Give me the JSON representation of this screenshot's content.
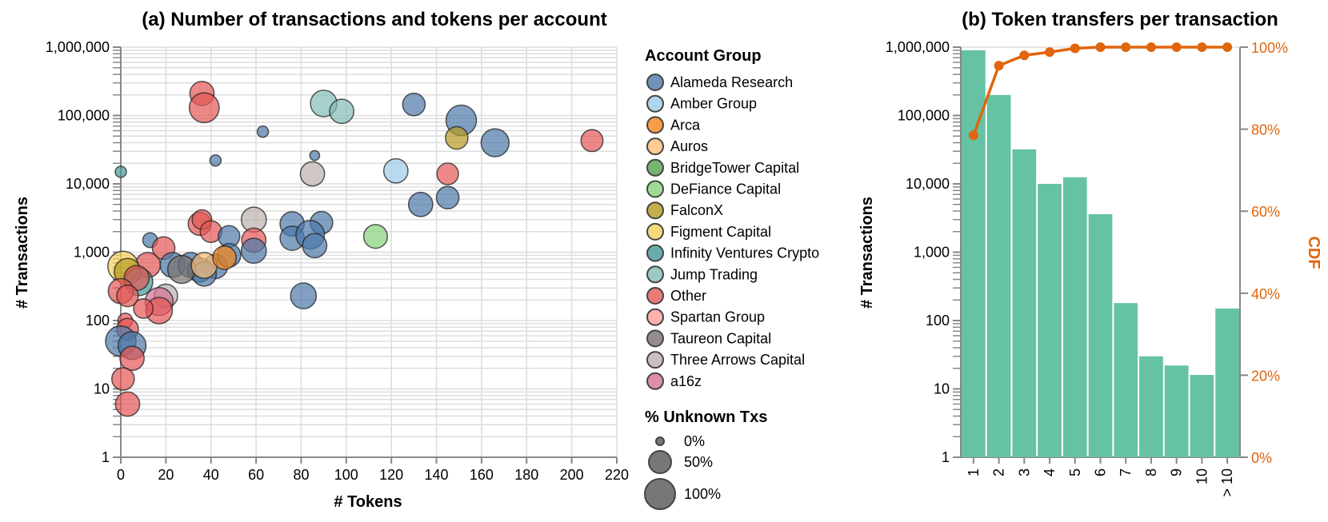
{
  "chart_data": [
    {
      "type": "scatter",
      "title": "(a) Number of transactions and tokens per account",
      "xlabel": "# Tokens",
      "ylabel": "# Transactions",
      "xlim": [
        0,
        220
      ],
      "ylim": [
        1,
        1000000
      ],
      "yscale": "log",
      "grid": true,
      "xticks": [
        0,
        20,
        40,
        60,
        80,
        100,
        120,
        140,
        160,
        180,
        200,
        220
      ],
      "yticks": [
        1,
        10,
        100,
        1000,
        10000,
        100000,
        1000000
      ],
      "ytick_labels": [
        "1",
        "10",
        "100",
        "1,000",
        "10,000",
        "100,000",
        "1,000,000"
      ],
      "legend": {
        "placement": "right",
        "color_title": "Account Group",
        "groups": [
          {
            "name": "Alameda Research",
            "color": "#4c78a8"
          },
          {
            "name": "Amber Group",
            "color": "#9ecae9"
          },
          {
            "name": "Arca",
            "color": "#f58518"
          },
          {
            "name": "Auros",
            "color": "#ffbf79"
          },
          {
            "name": "BridgeTower Capital",
            "color": "#54a24b"
          },
          {
            "name": "DeFiance Capital",
            "color": "#88d27a"
          },
          {
            "name": "FalconX",
            "color": "#b79a20"
          },
          {
            "name": "Figment Capital",
            "color": "#f2cf5b"
          },
          {
            "name": "Infinity Ventures Crypto",
            "color": "#439894"
          },
          {
            "name": "Jump Trading",
            "color": "#83bcb6"
          },
          {
            "name": "Other",
            "color": "#e45756"
          },
          {
            "name": "Spartan Group",
            "color": "#ff9d98"
          },
          {
            "name": "Taureon Capital",
            "color": "#79706e"
          },
          {
            "name": "Three Arrows Capital",
            "color": "#bab0ac"
          },
          {
            "name": "a16z",
            "color": "#d67195"
          }
        ],
        "size_title": "% Unknown Txs",
        "size_entries": [
          {
            "label": "0%",
            "value": 0
          },
          {
            "label": "50%",
            "value": 50
          },
          {
            "label": "100%",
            "value": 100
          }
        ]
      },
      "points": [
        {
          "group": "Other",
          "x": 36,
          "y": 210000,
          "unknown": 55
        },
        {
          "group": "Other",
          "x": 37,
          "y": 130000,
          "unknown": 95
        },
        {
          "group": "Alameda Research",
          "x": 63,
          "y": 58000,
          "unknown": 4
        },
        {
          "group": "Alameda Research",
          "x": 42,
          "y": 22000,
          "unknown": 4
        },
        {
          "group": "Alameda Research",
          "x": 86,
          "y": 26000,
          "unknown": 2
        },
        {
          "group": "Infinity Ventures Crypto",
          "x": 0,
          "y": 15000,
          "unknown": 4
        },
        {
          "group": "Jump Trading",
          "x": 90,
          "y": 150000,
          "unknown": 70
        },
        {
          "group": "Jump Trading",
          "x": 98,
          "y": 115000,
          "unknown": 55
        },
        {
          "group": "Alameda Research",
          "x": 130,
          "y": 145000,
          "unknown": 45
        },
        {
          "group": "Alameda Research",
          "x": 151,
          "y": 85000,
          "unknown": 100
        },
        {
          "group": "FalconX",
          "x": 149,
          "y": 47000,
          "unknown": 45
        },
        {
          "group": "Alameda Research",
          "x": 166,
          "y": 40000,
          "unknown": 80
        },
        {
          "group": "Other",
          "x": 209,
          "y": 43000,
          "unknown": 42
        },
        {
          "group": "Three Arrows Capital",
          "x": 85,
          "y": 14000,
          "unknown": 55
        },
        {
          "group": "Amber Group",
          "x": 122,
          "y": 15500,
          "unknown": 55
        },
        {
          "group": "Other",
          "x": 145,
          "y": 14000,
          "unknown": 40
        },
        {
          "group": "Alameda Research",
          "x": 145,
          "y": 6300,
          "unknown": 45
        },
        {
          "group": "Alameda Research",
          "x": 133,
          "y": 5000,
          "unknown": 55
        },
        {
          "group": "DeFiance Capital",
          "x": 113,
          "y": 1700,
          "unknown": 52
        },
        {
          "group": "Three Arrows Capital",
          "x": 59,
          "y": 3000,
          "unknown": 60
        },
        {
          "group": "Other",
          "x": 35,
          "y": 2600,
          "unknown": 48
        },
        {
          "group": "Other",
          "x": 36,
          "y": 3000,
          "unknown": 30
        },
        {
          "group": "Other",
          "x": 40,
          "y": 2000,
          "unknown": 40
        },
        {
          "group": "Other",
          "x": 59,
          "y": 1500,
          "unknown": 55
        },
        {
          "group": "Alameda Research",
          "x": 59,
          "y": 1050,
          "unknown": 60
        },
        {
          "group": "Alameda Research",
          "x": 48,
          "y": 1700,
          "unknown": 40
        },
        {
          "group": "Alameda Research",
          "x": 76,
          "y": 2600,
          "unknown": 55
        },
        {
          "group": "Alameda Research",
          "x": 89,
          "y": 2700,
          "unknown": 45
        },
        {
          "group": "Alameda Research",
          "x": 76,
          "y": 1600,
          "unknown": 55
        },
        {
          "group": "Alameda Research",
          "x": 84,
          "y": 1800,
          "unknown": 85
        },
        {
          "group": "Alameda Research",
          "x": 86,
          "y": 1250,
          "unknown": 55
        },
        {
          "group": "Alameda Research",
          "x": 81,
          "y": 230,
          "unknown": 65
        },
        {
          "group": "Alameda Research",
          "x": 13,
          "y": 1500,
          "unknown": 12
        },
        {
          "group": "Other",
          "x": 19,
          "y": 1150,
          "unknown": 45
        },
        {
          "group": "Other",
          "x": 12,
          "y": 650,
          "unknown": 60
        },
        {
          "group": "Alameda Research",
          "x": 23,
          "y": 650,
          "unknown": 60
        },
        {
          "group": "Alameda Research",
          "x": 31,
          "y": 650,
          "unknown": 60
        },
        {
          "group": "Alameda Research",
          "x": 42,
          "y": 620,
          "unknown": 55
        },
        {
          "group": "Alameda Research",
          "x": 48,
          "y": 900,
          "unknown": 50
        },
        {
          "group": "Alameda Research",
          "x": 35,
          "y": 550,
          "unknown": 55
        },
        {
          "group": "Alameda Research",
          "x": 37,
          "y": 480,
          "unknown": 55
        },
        {
          "group": "Taureon Capital",
          "x": 27,
          "y": 560,
          "unknown": 80
        },
        {
          "group": "Auros",
          "x": 37,
          "y": 640,
          "unknown": 65
        },
        {
          "group": "Arca",
          "x": 46,
          "y": 830,
          "unknown": 50
        },
        {
          "group": "Figment Capital",
          "x": 1,
          "y": 620,
          "unknown": 100
        },
        {
          "group": "FalconX",
          "x": 3,
          "y": 520,
          "unknown": 70
        },
        {
          "group": "Infinity Ventures Crypto",
          "x": 8,
          "y": 370,
          "unknown": 80
        },
        {
          "group": "Other",
          "x": 7,
          "y": 420,
          "unknown": 60
        },
        {
          "group": "Other",
          "x": 0,
          "y": 270,
          "unknown": 60
        },
        {
          "group": "Other",
          "x": 3,
          "y": 230,
          "unknown": 40
        },
        {
          "group": "Three Arrows Capital",
          "x": 20,
          "y": 230,
          "unknown": 50
        },
        {
          "group": "a16z",
          "x": 17,
          "y": 190,
          "unknown": 80
        },
        {
          "group": "Other",
          "x": 17,
          "y": 140,
          "unknown": 70
        },
        {
          "group": "Other",
          "x": 10,
          "y": 150,
          "unknown": 30
        },
        {
          "group": "Other",
          "x": 2,
          "y": 100,
          "unknown": 12
        },
        {
          "group": "Other",
          "x": 3,
          "y": 75,
          "unknown": 40
        },
        {
          "group": "Alameda Research",
          "x": 0,
          "y": 50,
          "unknown": 100
        },
        {
          "group": "Alameda Research",
          "x": 5,
          "y": 43,
          "unknown": 80
        },
        {
          "group": "Other",
          "x": 5,
          "y": 28,
          "unknown": 55
        },
        {
          "group": "Other",
          "x": 1,
          "y": 14,
          "unknown": 45
        },
        {
          "group": "Other",
          "x": 3,
          "y": 6,
          "unknown": 55
        }
      ]
    },
    {
      "type": "bar",
      "title": "(b) Token transfers per transaction",
      "xlabel": "",
      "ylabel": "# Transactions",
      "y2label": "CDF",
      "yscale": "log",
      "ylim": [
        1,
        1000000
      ],
      "y2lim": [
        0,
        100
      ],
      "yticks": [
        1,
        10,
        100,
        1000,
        10000,
        100000,
        1000000
      ],
      "ytick_labels": [
        "1",
        "10",
        "100",
        "1,000",
        "10,000",
        "100,000",
        "1,000,000"
      ],
      "y2ticks": [
        0,
        20,
        40,
        60,
        80,
        100
      ],
      "y2tick_labels": [
        "0%",
        "20%",
        "40%",
        "60%",
        "80%",
        "100%"
      ],
      "categories": [
        "1",
        "2",
        "3",
        "4",
        "5",
        "6",
        "7",
        "8",
        "9",
        "10",
        "> 10"
      ],
      "series": [
        {
          "name": "# Transactions",
          "type": "bar",
          "color": "#66c2a5",
          "values": [
            900000,
            200000,
            32000,
            10000,
            12500,
            3600,
            180,
            30,
            22,
            16,
            150
          ]
        },
        {
          "name": "CDF",
          "type": "line",
          "color": "#e0650c",
          "values": [
            78.5,
            95.5,
            98.0,
            98.8,
            99.7,
            100,
            100,
            100,
            100,
            100,
            100
          ]
        }
      ]
    }
  ]
}
